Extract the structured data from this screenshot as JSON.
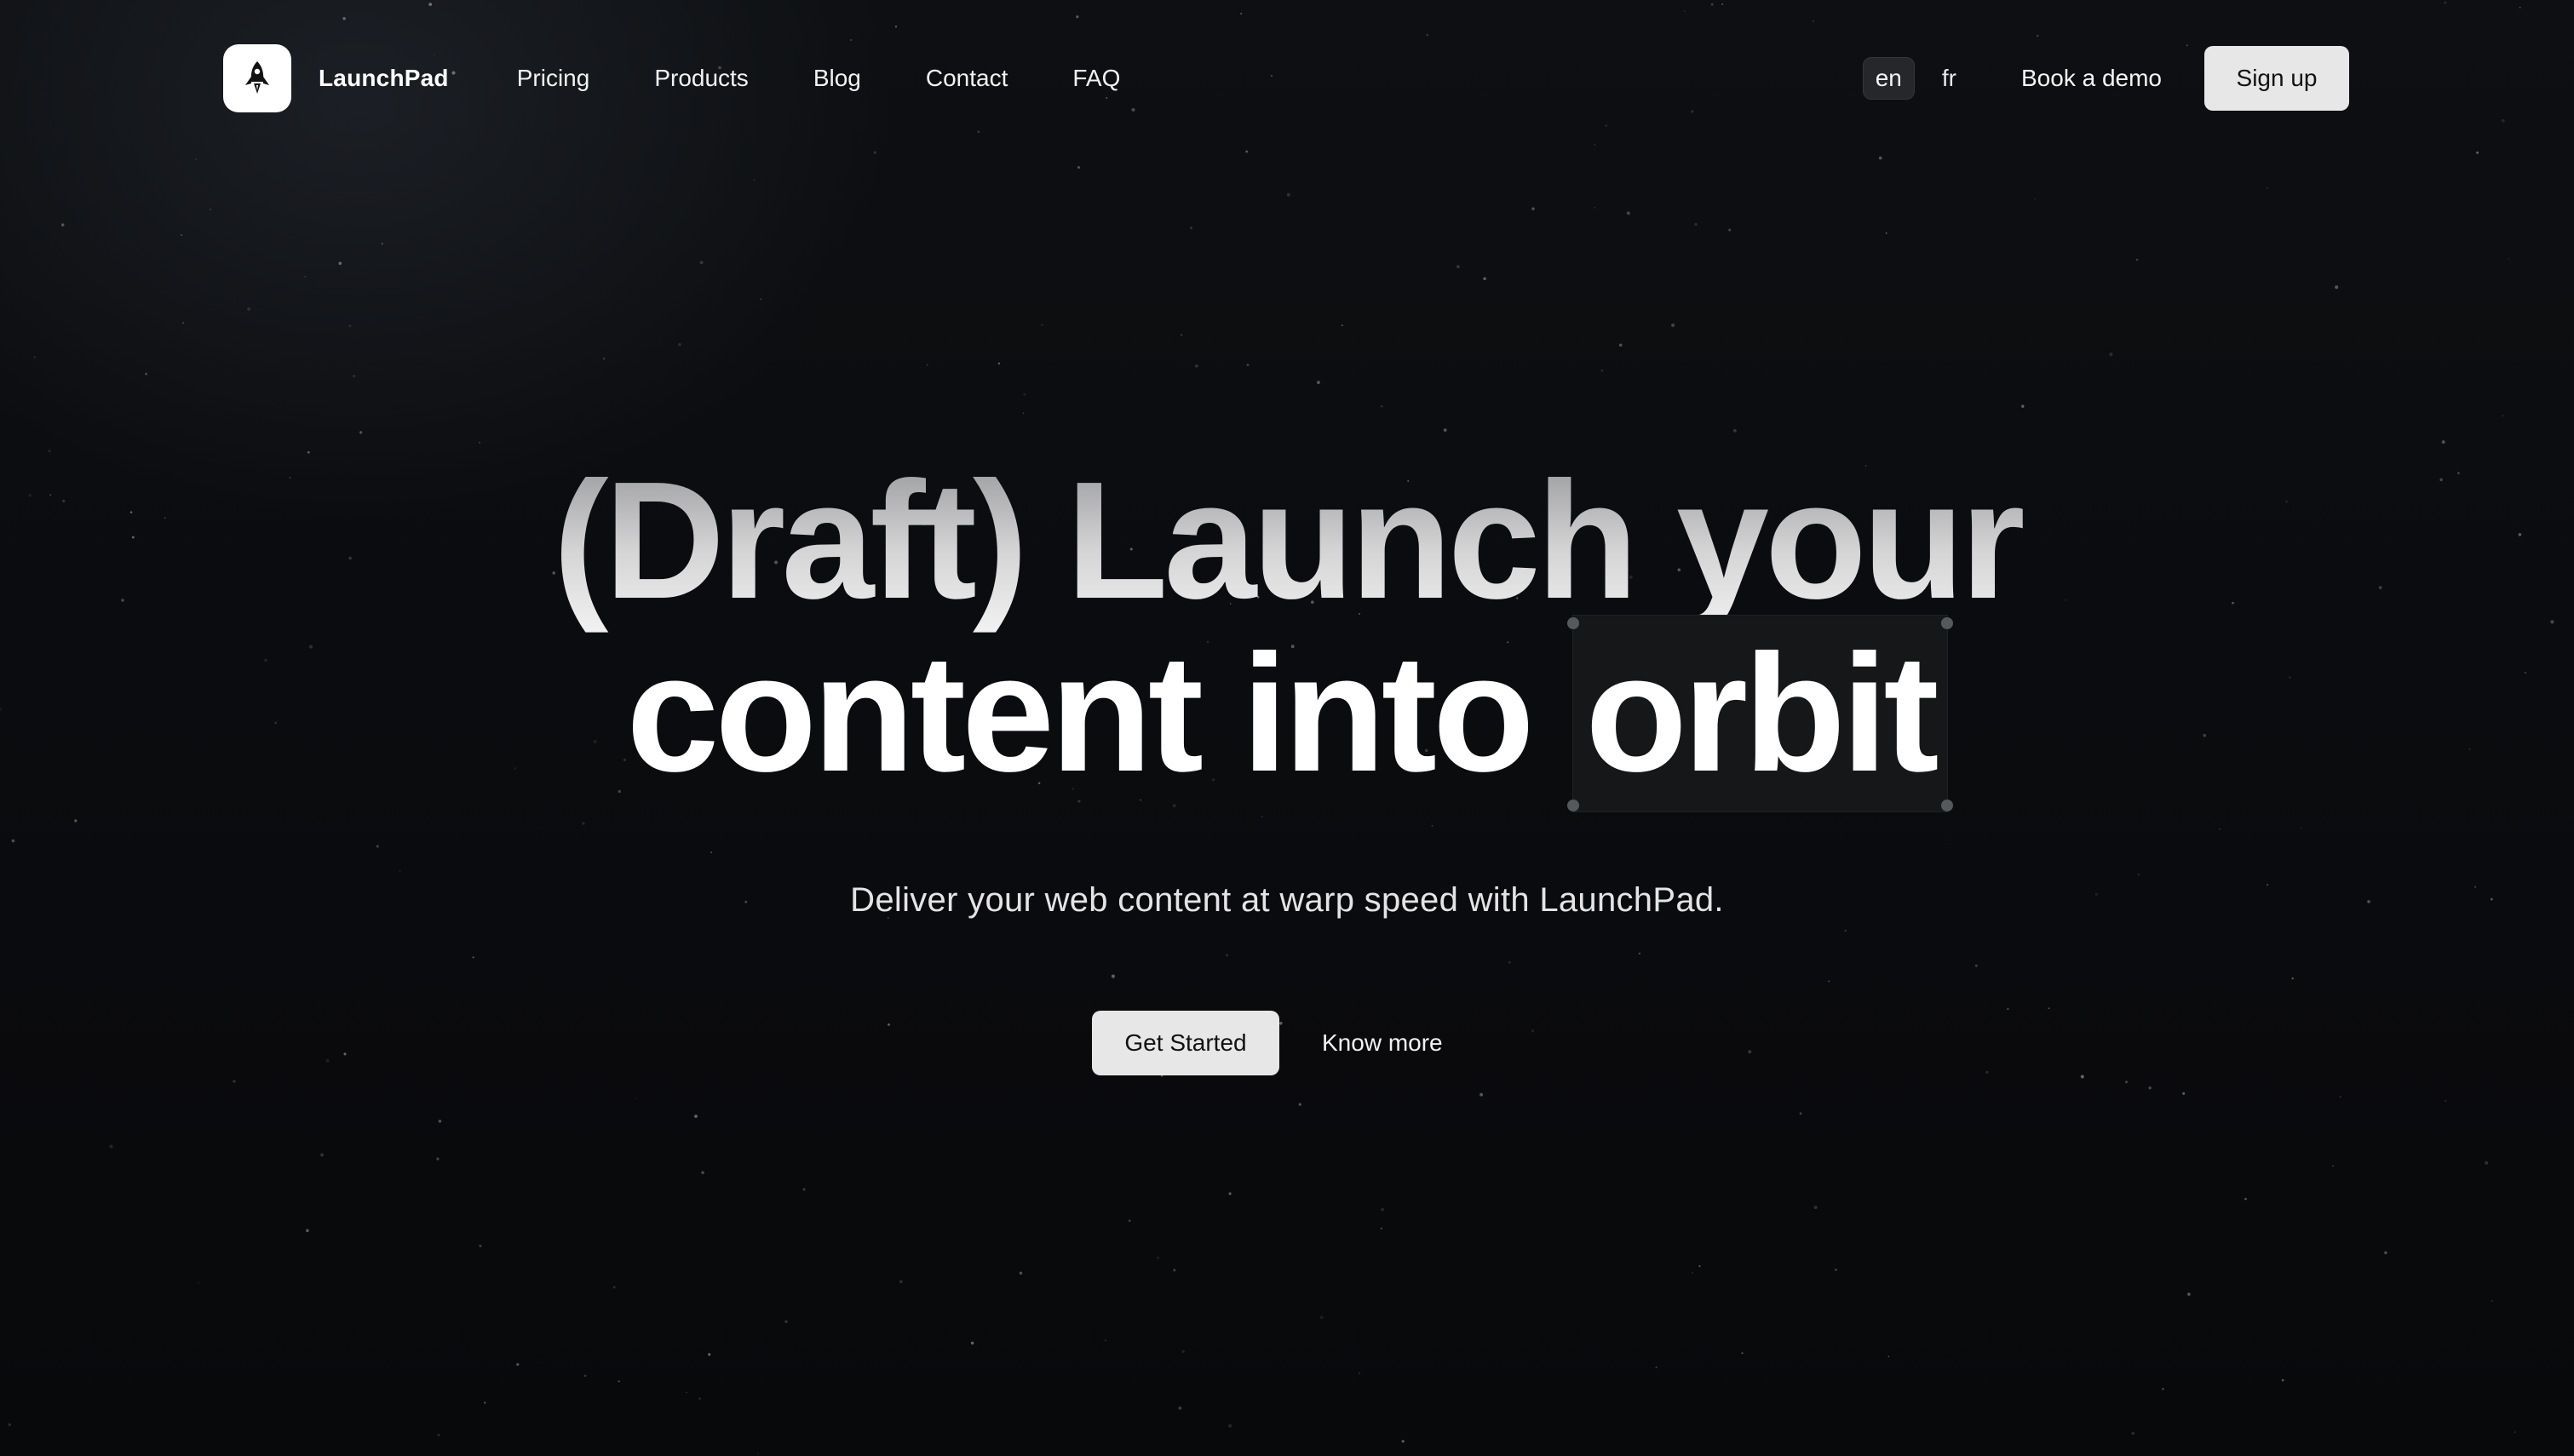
{
  "header": {
    "brand_name": "LaunchPad",
    "nav": [
      "Pricing",
      "Products",
      "Blog",
      "Contact",
      "FAQ"
    ],
    "languages": [
      "en",
      "fr"
    ],
    "active_language": "en",
    "book_demo": "Book a demo",
    "signup": "Sign up"
  },
  "hero": {
    "line1": "(Draft) Launch your",
    "line2_prefix": "content into",
    "line2_highlight": "orbit",
    "subtitle": "Deliver your web content at warp speed with LaunchPad.",
    "primary_cta": "Get Started",
    "secondary_cta": "Know more"
  },
  "colors": {
    "background": "#0a0b0d",
    "button_bg": "#e7e7e7",
    "button_text": "#111214",
    "text": "#ffffff"
  },
  "icons": {
    "logo": "rocket-icon"
  }
}
